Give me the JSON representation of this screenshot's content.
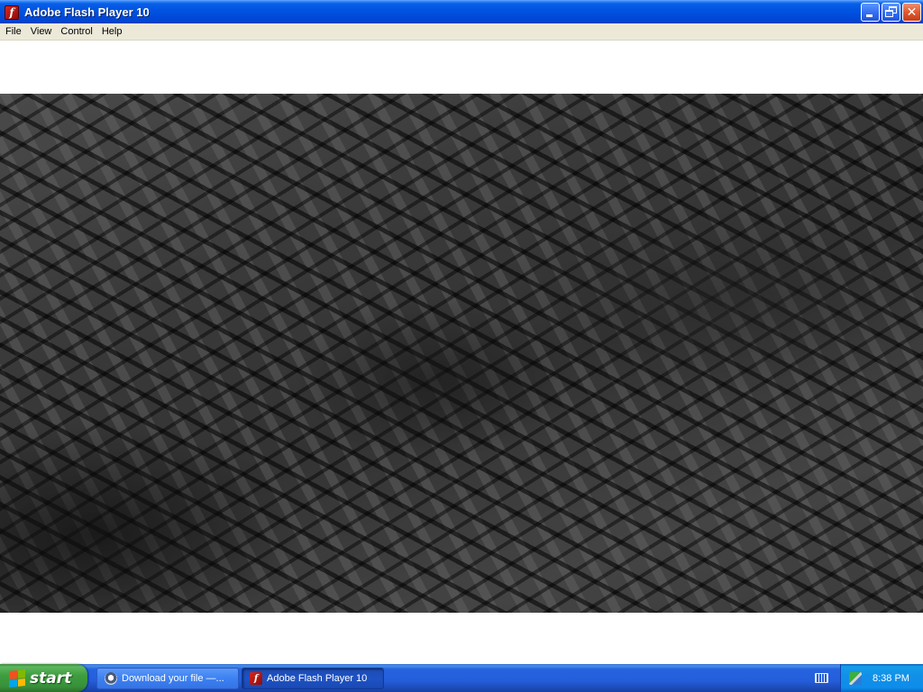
{
  "window": {
    "title": "Adobe Flash Player 10",
    "icon": "flash-player-icon"
  },
  "menubar": {
    "items": [
      "File",
      "View",
      "Control",
      "Help"
    ]
  },
  "content": {
    "stage": "flash-animation-dark-3d-blocks"
  },
  "taskbar": {
    "start_label": "start",
    "buttons": [
      {
        "label": "Download your file —...",
        "icon": "download-icon",
        "active": false
      },
      {
        "label": "Adobe Flash Player 10",
        "icon": "flash-player-icon",
        "active": true
      }
    ],
    "tray": {
      "keyboard_icon": "keyboard-icon",
      "network_icon": "network-icon",
      "clock": "8:38 PM"
    }
  },
  "colors": {
    "titlebar": "#0054e3",
    "menubar": "#ece9d8",
    "taskbar": "#245edb",
    "start_button": "#3f9d3f",
    "tray": "#1290e8"
  }
}
